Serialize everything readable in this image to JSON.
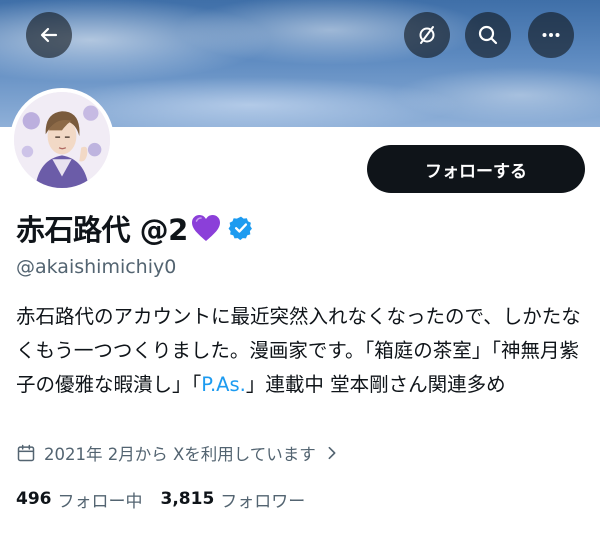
{
  "header": {
    "back_icon": "arrow-left-icon",
    "mute_icon": "mute-slash-icon",
    "search_icon": "search-icon",
    "more_icon": "more-horizontal-icon"
  },
  "profile": {
    "display_name": "赤石路代 @2",
    "name_emoji": "purple-heart-icon",
    "verified_icon": "verified-badge-icon",
    "handle": "@akaishimichiy0",
    "follow_button_label": "フォローする",
    "bio_before_link": "赤石路代のアカウントに最近突然入れなくなったので、しかたなくもう一つつくりました。漫画家です。「箱庭の茶室」「神無月紫子の優雅な暇潰し」「",
    "bio_link": "P.As.",
    "bio_after_link": "」連載中 堂本剛さん関連多め",
    "joined_text": "2021年 2月から Xを利用しています",
    "following_count": "496",
    "following_label": "フォロー中",
    "followers_count": "3,815",
    "followers_label": "フォロワー"
  },
  "colors": {
    "accent_link": "#1d9bf0",
    "text_primary": "#0f1419",
    "text_secondary": "#536471",
    "button_dark": "#0f1419",
    "verified_blue": "#1d9bf0",
    "heart_purple": "#8b3fd9"
  }
}
